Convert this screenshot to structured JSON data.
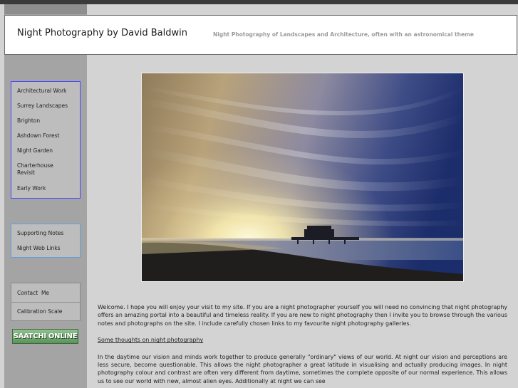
{
  "header": {
    "title": "Night Photography by David Baldwin",
    "tagline": "Night Photography of Landscapes and Architecture, often with an astronomical theme"
  },
  "nav": {
    "main": [
      "Architectural Work",
      "Surrey Landscapes",
      "Brighton",
      "Ashdown Forest",
      "Night Garden",
      "Charterhouse Revisit",
      "Early Work"
    ],
    "support": [
      "Supporting Notes",
      "Night Web Links"
    ],
    "contact": [
      "Contact  Me",
      "Calibration Scale"
    ]
  },
  "saatchi": {
    "label": "SAATCHI ONLINE"
  },
  "photo": {
    "subject": "night-seascape-pier-streaked-clouds"
  },
  "content": {
    "intro": "Welcome. I hope you will enjoy your visit to my site. If you are a night photographer yourself you will need no convincing that night photography offers an amazing portal into a beautiful and timeless reality. If you are new to night photography then I invite you to browse through the various notes and photographs on the site.   I include carefully chosen links to my favourite night photography galleries.",
    "link": "Some thoughts on night photography",
    "para2": "In the daytime our vision and minds work together to produce generally \"ordinary\" views of our world.   At night our vision and perceptions are less secure, become questionable.   This allows the night photographer a great latitude in visualising and actually producing images.   In night photography colour and contrast are often very different from daytime, sometimes the complete opposite of our normal experience.  This allows us to see our world with new, almost alien eyes.   Additionally at night we can see"
  },
  "colors": {
    "page_bg": "#d3d3d3",
    "sidebar_bg": "#a4a4a4",
    "nav_main_border": "#4a4aff",
    "nav_support_border": "#5aa0e6",
    "saatchi_green": "#6fa56f"
  }
}
